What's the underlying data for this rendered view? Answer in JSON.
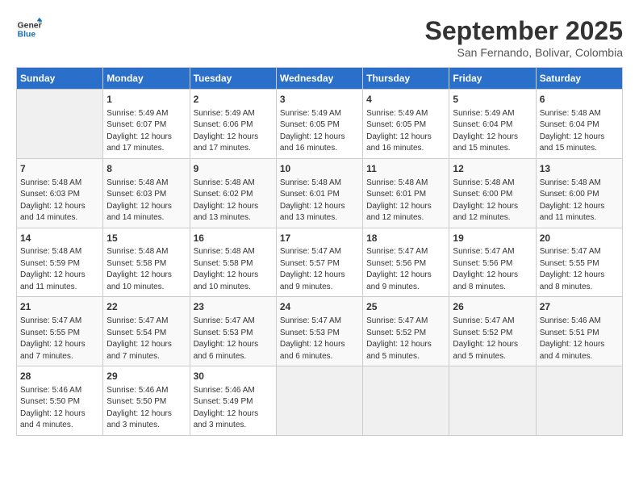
{
  "header": {
    "logo_line1": "General",
    "logo_line2": "Blue",
    "month": "September 2025",
    "location": "San Fernando, Bolivar, Colombia"
  },
  "weekdays": [
    "Sunday",
    "Monday",
    "Tuesday",
    "Wednesday",
    "Thursday",
    "Friday",
    "Saturday"
  ],
  "weeks": [
    [
      {
        "day": "",
        "empty": true
      },
      {
        "day": "1",
        "rise": "5:49 AM",
        "set": "6:07 PM",
        "daylight": "12 hours and 17 minutes."
      },
      {
        "day": "2",
        "rise": "5:49 AM",
        "set": "6:06 PM",
        "daylight": "12 hours and 17 minutes."
      },
      {
        "day": "3",
        "rise": "5:49 AM",
        "set": "6:05 PM",
        "daylight": "12 hours and 16 minutes."
      },
      {
        "day": "4",
        "rise": "5:49 AM",
        "set": "6:05 PM",
        "daylight": "12 hours and 16 minutes."
      },
      {
        "day": "5",
        "rise": "5:49 AM",
        "set": "6:04 PM",
        "daylight": "12 hours and 15 minutes."
      },
      {
        "day": "6",
        "rise": "5:48 AM",
        "set": "6:04 PM",
        "daylight": "12 hours and 15 minutes."
      }
    ],
    [
      {
        "day": "7",
        "rise": "5:48 AM",
        "set": "6:03 PM",
        "daylight": "12 hours and 14 minutes."
      },
      {
        "day": "8",
        "rise": "5:48 AM",
        "set": "6:03 PM",
        "daylight": "12 hours and 14 minutes."
      },
      {
        "day": "9",
        "rise": "5:48 AM",
        "set": "6:02 PM",
        "daylight": "12 hours and 13 minutes."
      },
      {
        "day": "10",
        "rise": "5:48 AM",
        "set": "6:01 PM",
        "daylight": "12 hours and 13 minutes."
      },
      {
        "day": "11",
        "rise": "5:48 AM",
        "set": "6:01 PM",
        "daylight": "12 hours and 12 minutes."
      },
      {
        "day": "12",
        "rise": "5:48 AM",
        "set": "6:00 PM",
        "daylight": "12 hours and 12 minutes."
      },
      {
        "day": "13",
        "rise": "5:48 AM",
        "set": "6:00 PM",
        "daylight": "12 hours and 11 minutes."
      }
    ],
    [
      {
        "day": "14",
        "rise": "5:48 AM",
        "set": "5:59 PM",
        "daylight": "12 hours and 11 minutes."
      },
      {
        "day": "15",
        "rise": "5:48 AM",
        "set": "5:58 PM",
        "daylight": "12 hours and 10 minutes."
      },
      {
        "day": "16",
        "rise": "5:48 AM",
        "set": "5:58 PM",
        "daylight": "12 hours and 10 minutes."
      },
      {
        "day": "17",
        "rise": "5:47 AM",
        "set": "5:57 PM",
        "daylight": "12 hours and 9 minutes."
      },
      {
        "day": "18",
        "rise": "5:47 AM",
        "set": "5:56 PM",
        "daylight": "12 hours and 9 minutes."
      },
      {
        "day": "19",
        "rise": "5:47 AM",
        "set": "5:56 PM",
        "daylight": "12 hours and 8 minutes."
      },
      {
        "day": "20",
        "rise": "5:47 AM",
        "set": "5:55 PM",
        "daylight": "12 hours and 8 minutes."
      }
    ],
    [
      {
        "day": "21",
        "rise": "5:47 AM",
        "set": "5:55 PM",
        "daylight": "12 hours and 7 minutes."
      },
      {
        "day": "22",
        "rise": "5:47 AM",
        "set": "5:54 PM",
        "daylight": "12 hours and 7 minutes."
      },
      {
        "day": "23",
        "rise": "5:47 AM",
        "set": "5:53 PM",
        "daylight": "12 hours and 6 minutes."
      },
      {
        "day": "24",
        "rise": "5:47 AM",
        "set": "5:53 PM",
        "daylight": "12 hours and 6 minutes."
      },
      {
        "day": "25",
        "rise": "5:47 AM",
        "set": "5:52 PM",
        "daylight": "12 hours and 5 minutes."
      },
      {
        "day": "26",
        "rise": "5:47 AM",
        "set": "5:52 PM",
        "daylight": "12 hours and 5 minutes."
      },
      {
        "day": "27",
        "rise": "5:46 AM",
        "set": "5:51 PM",
        "daylight": "12 hours and 4 minutes."
      }
    ],
    [
      {
        "day": "28",
        "rise": "5:46 AM",
        "set": "5:50 PM",
        "daylight": "12 hours and 4 minutes."
      },
      {
        "day": "29",
        "rise": "5:46 AM",
        "set": "5:50 PM",
        "daylight": "12 hours and 3 minutes."
      },
      {
        "day": "30",
        "rise": "5:46 AM",
        "set": "5:49 PM",
        "daylight": "12 hours and 3 minutes."
      },
      {
        "day": "",
        "empty": true
      },
      {
        "day": "",
        "empty": true
      },
      {
        "day": "",
        "empty": true
      },
      {
        "day": "",
        "empty": true
      }
    ]
  ],
  "labels": {
    "sunrise": "Sunrise:",
    "sunset": "Sunset:",
    "daylight": "Daylight:"
  }
}
